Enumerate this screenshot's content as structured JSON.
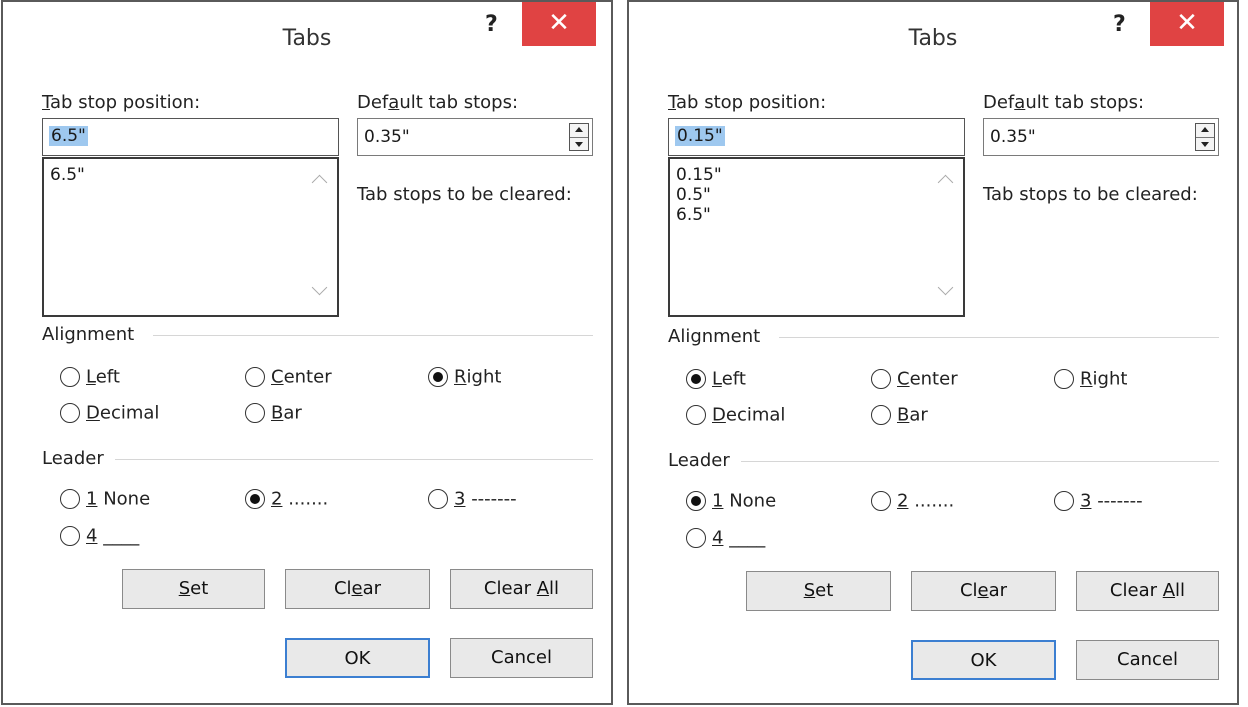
{
  "dialogs": [
    {
      "title": "Tabs",
      "help": "?",
      "close": "✕",
      "tab_stop_label_pre": "T",
      "tab_stop_label_post": "ab stop position:",
      "tab_stop_value": "6.5\"",
      "tab_stop_list": "6.5\"",
      "default_label_pre": "Def",
      "default_label_mid": "a",
      "default_label_post": "ult tab stops:",
      "default_value": "0.35\"",
      "cleared_label": "Tab stops to be cleared:",
      "alignment_label": "Alignment",
      "alignment": {
        "left": "Left",
        "center": "Center",
        "right": "Right",
        "decimal": "Decimal",
        "bar": "Bar",
        "selected": "Right"
      },
      "leader_label": "Leader",
      "leader": {
        "none": "None",
        "dots": ".......",
        "dashes": "-------",
        "line": "____",
        "selected": "2"
      },
      "buttons": {
        "set": "Set",
        "clear": "Clear",
        "clear_all": "Clear All",
        "ok": "OK",
        "cancel": "Cancel"
      }
    },
    {
      "title": "Tabs",
      "help": "?",
      "close": "✕",
      "tab_stop_label_pre": "T",
      "tab_stop_label_post": "ab stop position:",
      "tab_stop_value": "0.15\"",
      "tab_stop_list": "0.15\"\n0.5\"\n6.5\"",
      "default_label_pre": "Def",
      "default_label_mid": "a",
      "default_label_post": "ult tab stops:",
      "default_value": "0.35\"",
      "cleared_label": "Tab stops to be cleared:",
      "alignment_label": "Alignment",
      "alignment": {
        "left": "Left",
        "center": "Center",
        "right": "Right",
        "decimal": "Decimal",
        "bar": "Bar",
        "selected": "Left"
      },
      "leader_label": "Leader",
      "leader": {
        "none": "None",
        "dots": ".......",
        "dashes": "-------",
        "line": "____",
        "selected": "1"
      },
      "buttons": {
        "set": "Set",
        "clear": "Clear",
        "clear_all": "Clear All",
        "ok": "OK",
        "cancel": "Cancel"
      }
    }
  ],
  "colors": {
    "close_button": "#e04343",
    "selection": "#9ec8ef",
    "ok_border": "#3c7fd1"
  }
}
